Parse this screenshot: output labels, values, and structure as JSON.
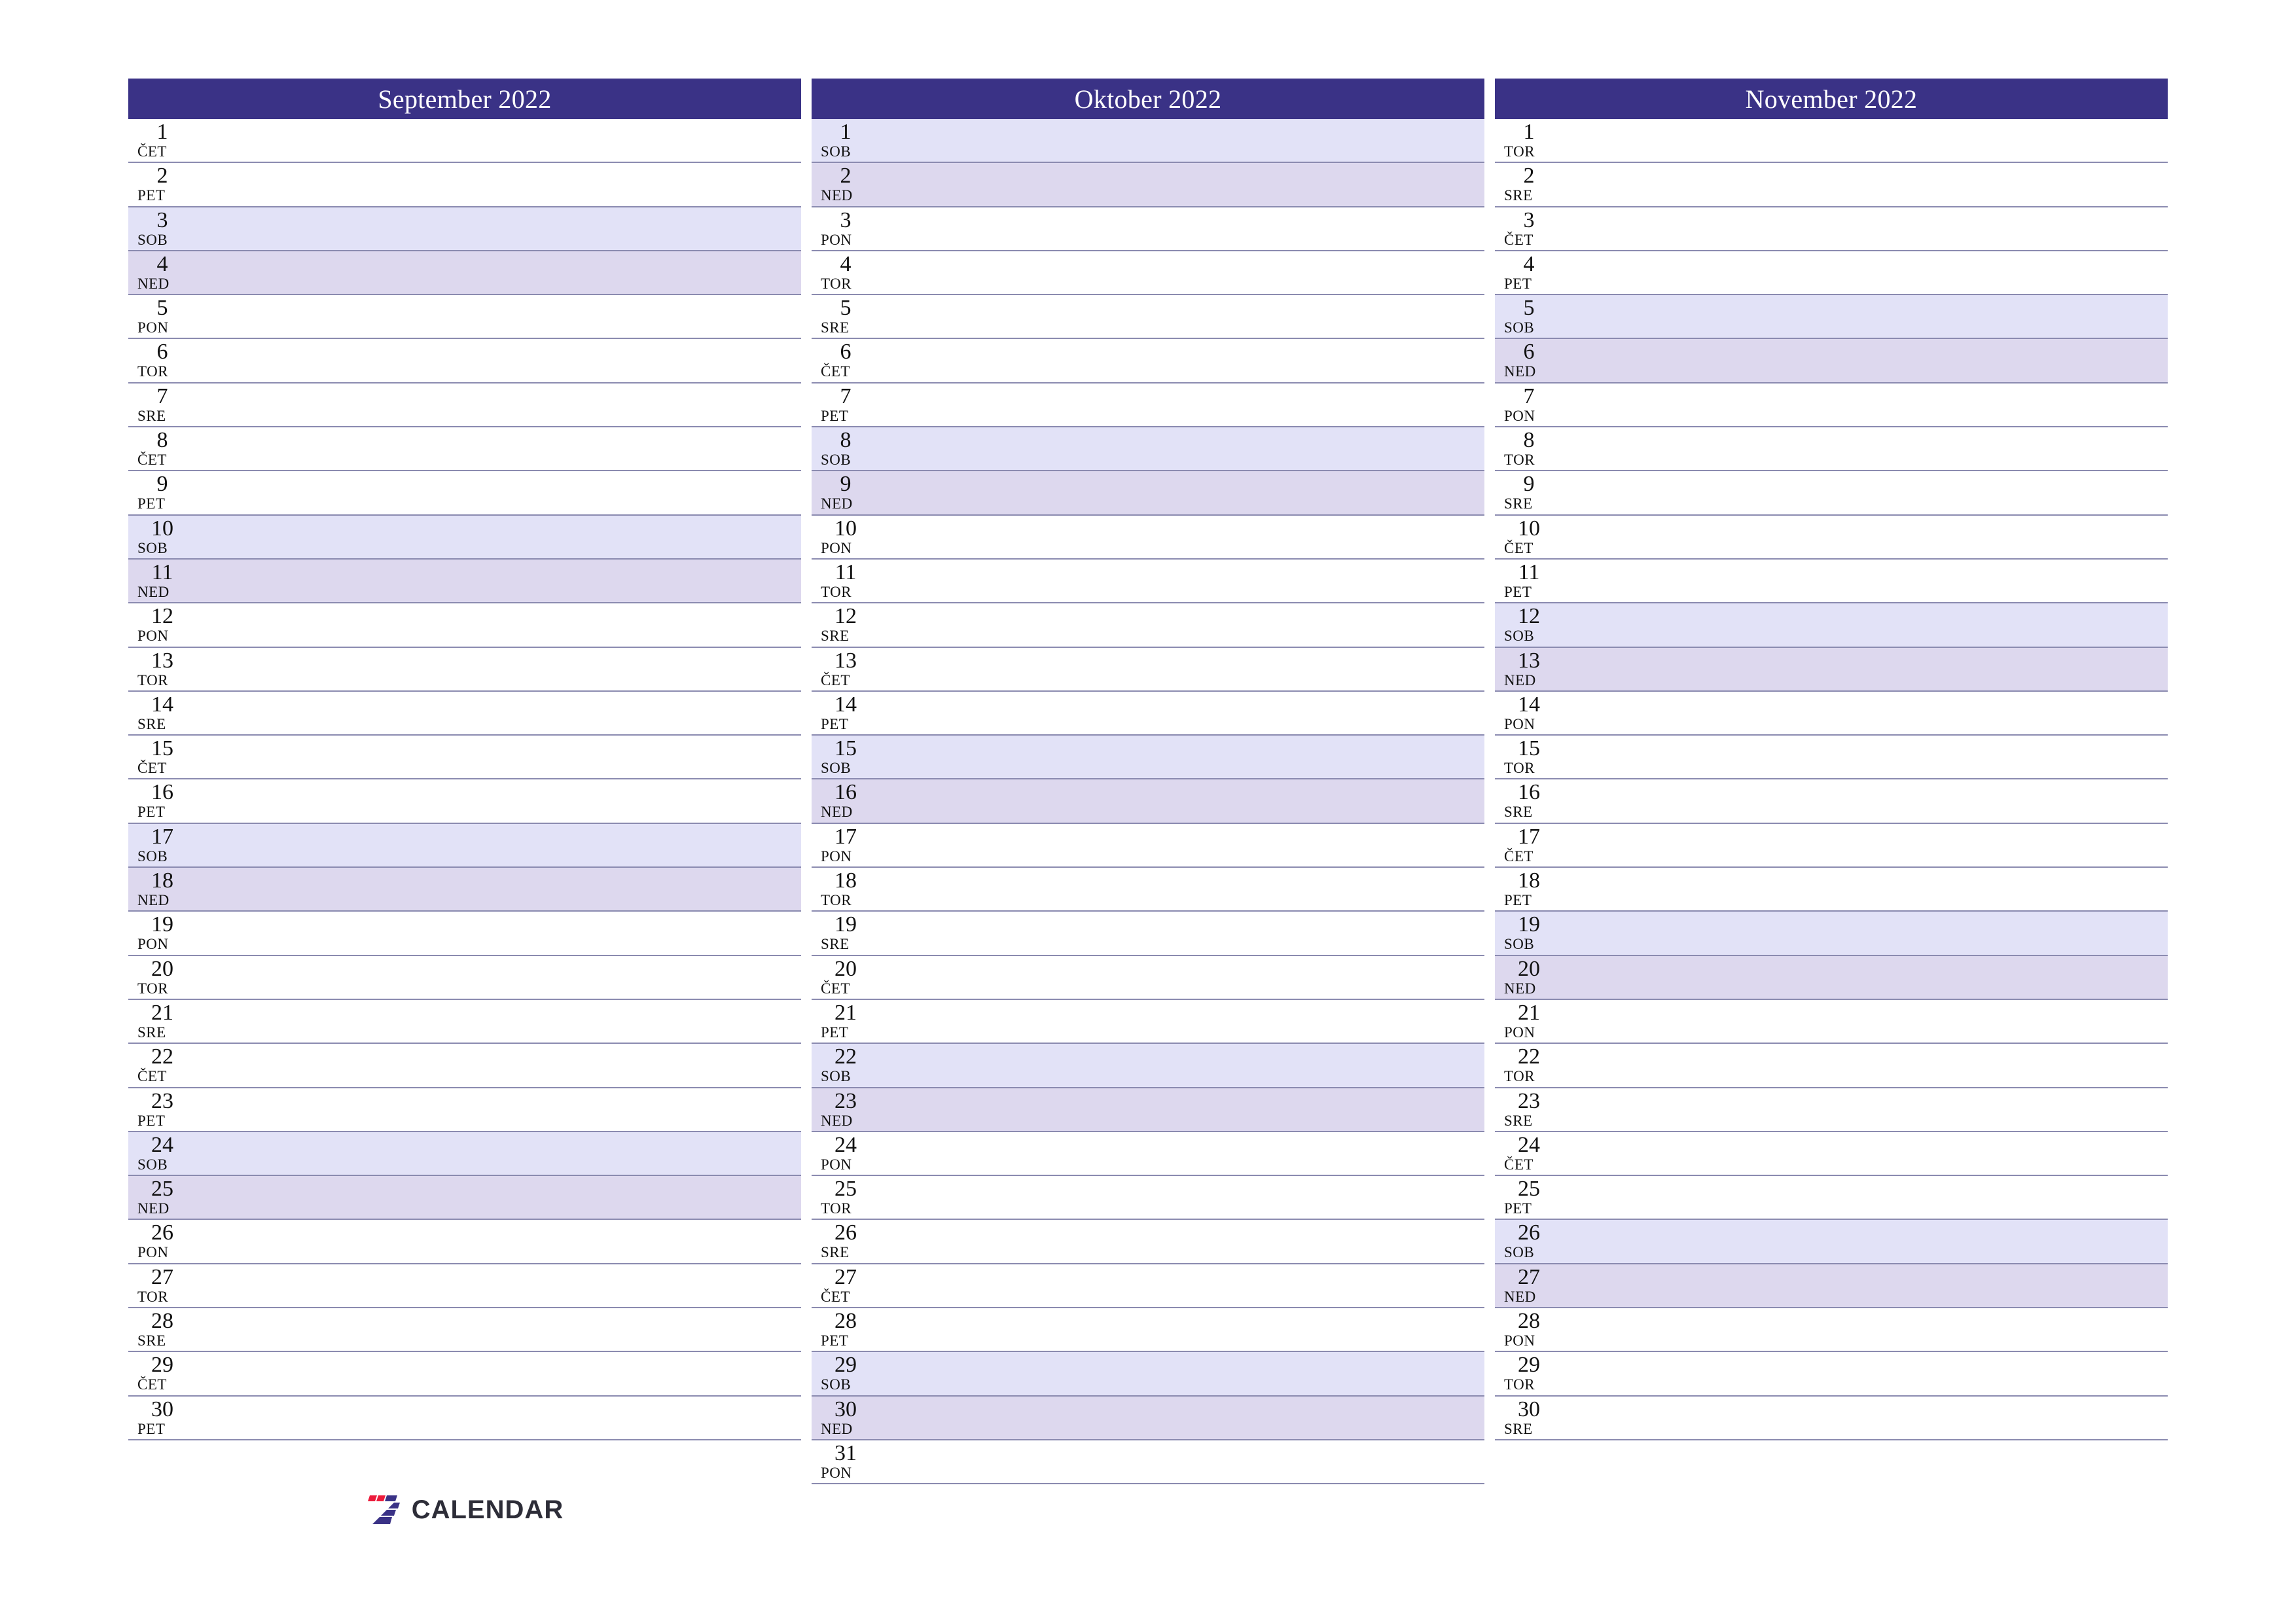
{
  "brand": {
    "logo_icon": "seven-logo-icon",
    "name": "CALENDAR",
    "red": "#ec1b3b",
    "blue": "#3a3286"
  },
  "theme": {
    "header_bg": "#3a3286",
    "header_text": "#ffffff",
    "saturday_bg": "#e2e2f7",
    "sunday_bg": "#ddd8ee",
    "rule": "#8b8bb0",
    "page_bg": "#ffffff"
  },
  "weekday_abbr": {
    "mon": "PON",
    "tue": "TOR",
    "wed": "SRE",
    "thu": "ČET",
    "fri": "PET",
    "sat": "SOB",
    "sun": "NED"
  },
  "months": [
    {
      "title": "September 2022",
      "days": [
        {
          "n": "1",
          "abbr": "ČET",
          "kind": "weekday"
        },
        {
          "n": "2",
          "abbr": "PET",
          "kind": "weekday"
        },
        {
          "n": "3",
          "abbr": "SOB",
          "kind": "sat"
        },
        {
          "n": "4",
          "abbr": "NED",
          "kind": "sun"
        },
        {
          "n": "5",
          "abbr": "PON",
          "kind": "weekday"
        },
        {
          "n": "6",
          "abbr": "TOR",
          "kind": "weekday"
        },
        {
          "n": "7",
          "abbr": "SRE",
          "kind": "weekday"
        },
        {
          "n": "8",
          "abbr": "ČET",
          "kind": "weekday"
        },
        {
          "n": "9",
          "abbr": "PET",
          "kind": "weekday"
        },
        {
          "n": "10",
          "abbr": "SOB",
          "kind": "sat"
        },
        {
          "n": "11",
          "abbr": "NED",
          "kind": "sun"
        },
        {
          "n": "12",
          "abbr": "PON",
          "kind": "weekday"
        },
        {
          "n": "13",
          "abbr": "TOR",
          "kind": "weekday"
        },
        {
          "n": "14",
          "abbr": "SRE",
          "kind": "weekday"
        },
        {
          "n": "15",
          "abbr": "ČET",
          "kind": "weekday"
        },
        {
          "n": "16",
          "abbr": "PET",
          "kind": "weekday"
        },
        {
          "n": "17",
          "abbr": "SOB",
          "kind": "sat"
        },
        {
          "n": "18",
          "abbr": "NED",
          "kind": "sun"
        },
        {
          "n": "19",
          "abbr": "PON",
          "kind": "weekday"
        },
        {
          "n": "20",
          "abbr": "TOR",
          "kind": "weekday"
        },
        {
          "n": "21",
          "abbr": "SRE",
          "kind": "weekday"
        },
        {
          "n": "22",
          "abbr": "ČET",
          "kind": "weekday"
        },
        {
          "n": "23",
          "abbr": "PET",
          "kind": "weekday"
        },
        {
          "n": "24",
          "abbr": "SOB",
          "kind": "sat"
        },
        {
          "n": "25",
          "abbr": "NED",
          "kind": "sun"
        },
        {
          "n": "26",
          "abbr": "PON",
          "kind": "weekday"
        },
        {
          "n": "27",
          "abbr": "TOR",
          "kind": "weekday"
        },
        {
          "n": "28",
          "abbr": "SRE",
          "kind": "weekday"
        },
        {
          "n": "29",
          "abbr": "ČET",
          "kind": "weekday"
        },
        {
          "n": "30",
          "abbr": "PET",
          "kind": "weekday"
        }
      ]
    },
    {
      "title": "Oktober 2022",
      "days": [
        {
          "n": "1",
          "abbr": "SOB",
          "kind": "sat"
        },
        {
          "n": "2",
          "abbr": "NED",
          "kind": "sun"
        },
        {
          "n": "3",
          "abbr": "PON",
          "kind": "weekday"
        },
        {
          "n": "4",
          "abbr": "TOR",
          "kind": "weekday"
        },
        {
          "n": "5",
          "abbr": "SRE",
          "kind": "weekday"
        },
        {
          "n": "6",
          "abbr": "ČET",
          "kind": "weekday"
        },
        {
          "n": "7",
          "abbr": "PET",
          "kind": "weekday"
        },
        {
          "n": "8",
          "abbr": "SOB",
          "kind": "sat"
        },
        {
          "n": "9",
          "abbr": "NED",
          "kind": "sun"
        },
        {
          "n": "10",
          "abbr": "PON",
          "kind": "weekday"
        },
        {
          "n": "11",
          "abbr": "TOR",
          "kind": "weekday"
        },
        {
          "n": "12",
          "abbr": "SRE",
          "kind": "weekday"
        },
        {
          "n": "13",
          "abbr": "ČET",
          "kind": "weekday"
        },
        {
          "n": "14",
          "abbr": "PET",
          "kind": "weekday"
        },
        {
          "n": "15",
          "abbr": "SOB",
          "kind": "sat"
        },
        {
          "n": "16",
          "abbr": "NED",
          "kind": "sun"
        },
        {
          "n": "17",
          "abbr": "PON",
          "kind": "weekday"
        },
        {
          "n": "18",
          "abbr": "TOR",
          "kind": "weekday"
        },
        {
          "n": "19",
          "abbr": "SRE",
          "kind": "weekday"
        },
        {
          "n": "20",
          "abbr": "ČET",
          "kind": "weekday"
        },
        {
          "n": "21",
          "abbr": "PET",
          "kind": "weekday"
        },
        {
          "n": "22",
          "abbr": "SOB",
          "kind": "sat"
        },
        {
          "n": "23",
          "abbr": "NED",
          "kind": "sun"
        },
        {
          "n": "24",
          "abbr": "PON",
          "kind": "weekday"
        },
        {
          "n": "25",
          "abbr": "TOR",
          "kind": "weekday"
        },
        {
          "n": "26",
          "abbr": "SRE",
          "kind": "weekday"
        },
        {
          "n": "27",
          "abbr": "ČET",
          "kind": "weekday"
        },
        {
          "n": "28",
          "abbr": "PET",
          "kind": "weekday"
        },
        {
          "n": "29",
          "abbr": "SOB",
          "kind": "sat"
        },
        {
          "n": "30",
          "abbr": "NED",
          "kind": "sun"
        },
        {
          "n": "31",
          "abbr": "PON",
          "kind": "weekday"
        }
      ]
    },
    {
      "title": "November 2022",
      "days": [
        {
          "n": "1",
          "abbr": "TOR",
          "kind": "weekday"
        },
        {
          "n": "2",
          "abbr": "SRE",
          "kind": "weekday"
        },
        {
          "n": "3",
          "abbr": "ČET",
          "kind": "weekday"
        },
        {
          "n": "4",
          "abbr": "PET",
          "kind": "weekday"
        },
        {
          "n": "5",
          "abbr": "SOB",
          "kind": "sat"
        },
        {
          "n": "6",
          "abbr": "NED",
          "kind": "sun"
        },
        {
          "n": "7",
          "abbr": "PON",
          "kind": "weekday"
        },
        {
          "n": "8",
          "abbr": "TOR",
          "kind": "weekday"
        },
        {
          "n": "9",
          "abbr": "SRE",
          "kind": "weekday"
        },
        {
          "n": "10",
          "abbr": "ČET",
          "kind": "weekday"
        },
        {
          "n": "11",
          "abbr": "PET",
          "kind": "weekday"
        },
        {
          "n": "12",
          "abbr": "SOB",
          "kind": "sat"
        },
        {
          "n": "13",
          "abbr": "NED",
          "kind": "sun"
        },
        {
          "n": "14",
          "abbr": "PON",
          "kind": "weekday"
        },
        {
          "n": "15",
          "abbr": "TOR",
          "kind": "weekday"
        },
        {
          "n": "16",
          "abbr": "SRE",
          "kind": "weekday"
        },
        {
          "n": "17",
          "abbr": "ČET",
          "kind": "weekday"
        },
        {
          "n": "18",
          "abbr": "PET",
          "kind": "weekday"
        },
        {
          "n": "19",
          "abbr": "SOB",
          "kind": "sat"
        },
        {
          "n": "20",
          "abbr": "NED",
          "kind": "sun"
        },
        {
          "n": "21",
          "abbr": "PON",
          "kind": "weekday"
        },
        {
          "n": "22",
          "abbr": "TOR",
          "kind": "weekday"
        },
        {
          "n": "23",
          "abbr": "SRE",
          "kind": "weekday"
        },
        {
          "n": "24",
          "abbr": "ČET",
          "kind": "weekday"
        },
        {
          "n": "25",
          "abbr": "PET",
          "kind": "weekday"
        },
        {
          "n": "26",
          "abbr": "SOB",
          "kind": "sat"
        },
        {
          "n": "27",
          "abbr": "NED",
          "kind": "sun"
        },
        {
          "n": "28",
          "abbr": "PON",
          "kind": "weekday"
        },
        {
          "n": "29",
          "abbr": "TOR",
          "kind": "weekday"
        },
        {
          "n": "30",
          "abbr": "SRE",
          "kind": "weekday"
        }
      ]
    }
  ]
}
